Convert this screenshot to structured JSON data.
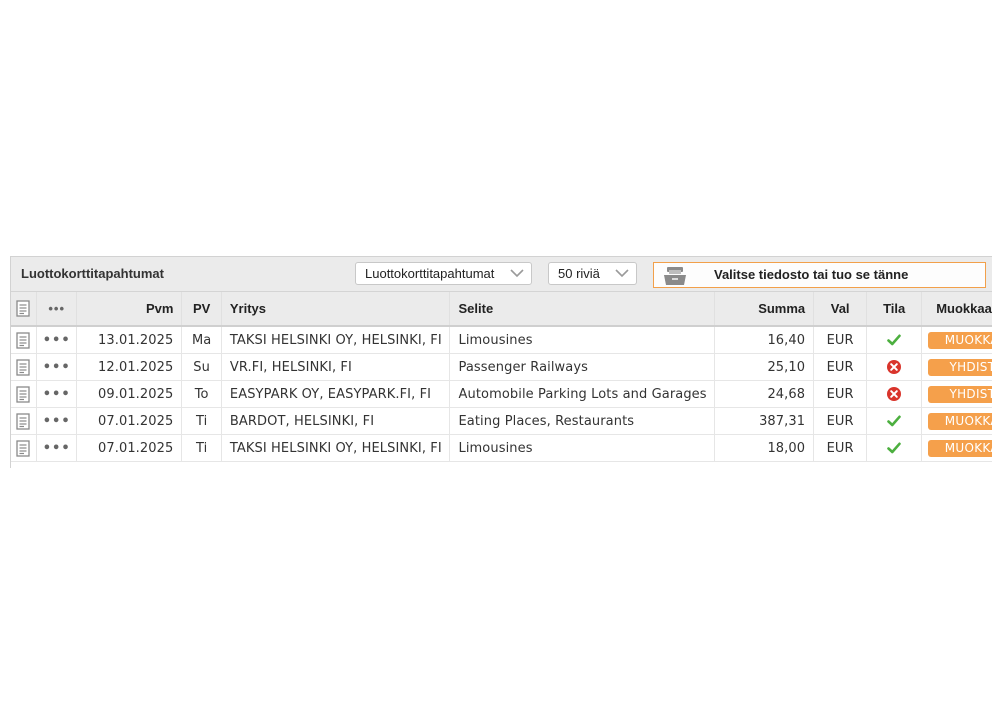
{
  "panel": {
    "title": "Luottokorttitapahtumat",
    "type_select": {
      "value": "Luottokorttitapahtumat"
    },
    "rows_select": {
      "value": "50 riviä"
    },
    "dropzone": {
      "label": "Valitse tiedosto tai tuo se tänne"
    }
  },
  "table": {
    "headers": {
      "more": "•••",
      "date": "Pvm",
      "day": "PV",
      "company": "Yritys",
      "description": "Selite",
      "amount": "Summa",
      "currency": "Val",
      "status": "Tila",
      "edit": "Muokkaa"
    },
    "rows": [
      {
        "date": "13.01.2025",
        "day": "Ma",
        "company": "TAKSI HELSINKI OY, HELSINKI, FI",
        "description": "Limousines",
        "amount": "16,40",
        "currency": "EUR",
        "status": "ok",
        "action": "MUOKKAA"
      },
      {
        "date": "12.01.2025",
        "day": "Su",
        "company": "VR.FI, HELSINKI, FI",
        "description": "Passenger Railways",
        "amount": "25,10",
        "currency": "EUR",
        "status": "error",
        "action": "YHDISTÄ"
      },
      {
        "date": "09.01.2025",
        "day": "To",
        "company": "EASYPARK OY, EASYPARK.FI, FI",
        "description": "Automobile Parking Lots and Garages",
        "amount": "24,68",
        "currency": "EUR",
        "status": "error",
        "action": "YHDISTÄ"
      },
      {
        "date": "07.01.2025",
        "day": "Ti",
        "company": "BARDOT, HELSINKI, FI",
        "description": "Eating Places, Restaurants",
        "amount": "387,31",
        "currency": "EUR",
        "status": "ok",
        "action": "MUOKKAA"
      },
      {
        "date": "07.01.2025",
        "day": "Ti",
        "company": "TAKSI HELSINKI OY, HELSINKI, FI",
        "description": "Limousines",
        "amount": "18,00",
        "currency": "EUR",
        "status": "ok",
        "action": "MUOKKAA"
      }
    ]
  },
  "colors": {
    "accent": "#f5a04b",
    "ok": "#4caf3f",
    "error": "#d9342b",
    "header_bg": "#ebebeb"
  },
  "icons": {
    "row_icon": "document-icon",
    "more_icon": "more-dots-icon",
    "status_ok": "check-icon",
    "status_error": "error-circle-icon",
    "dropzone_icon": "file-tray-icon"
  }
}
